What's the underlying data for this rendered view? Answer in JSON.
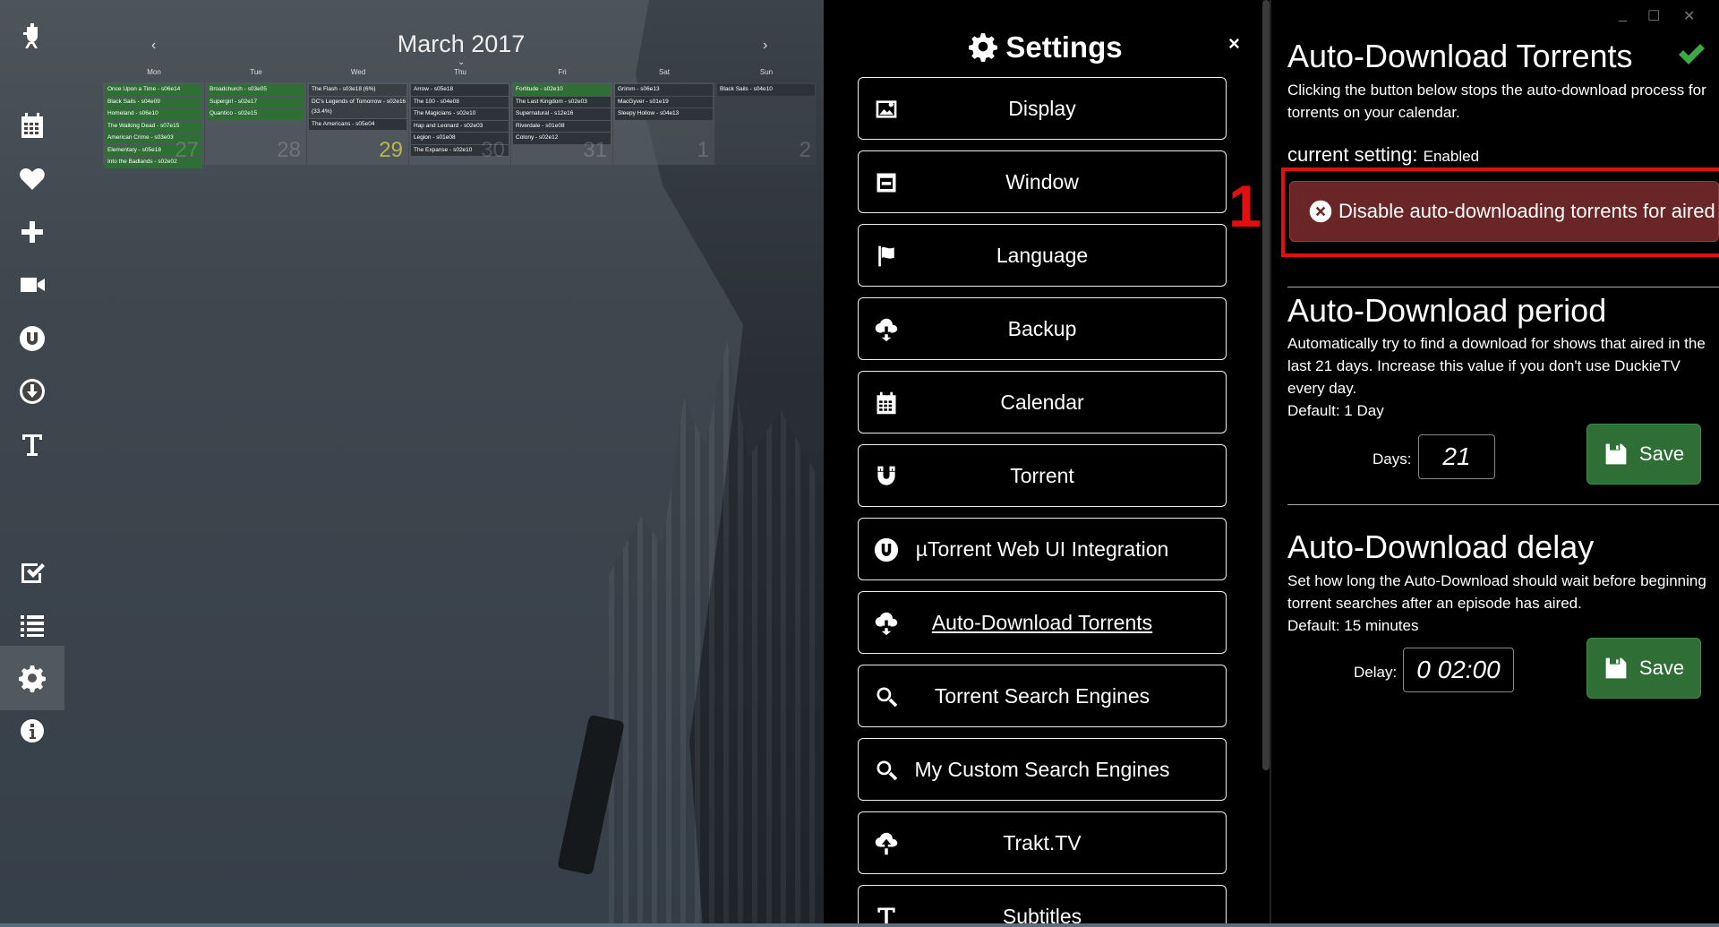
{
  "calendar": {
    "title": "March 2017",
    "prev": "‹",
    "next": "›",
    "expand": "⌄",
    "days": [
      "Mon",
      "Tue",
      "Wed",
      "Thu",
      "Fri",
      "Sat",
      "Sun"
    ],
    "cells": [
      {
        "num": "27",
        "events": [
          {
            "t": "Once Upon a Time - s06e14",
            "s": "g"
          },
          {
            "t": "Black Sails - s04e09",
            "s": "g"
          },
          {
            "t": "Homeland - s06e10",
            "s": "g"
          },
          {
            "t": "The Walking Dead - s07e15",
            "s": "g"
          },
          {
            "t": "American Crime - s03e03",
            "s": "g"
          },
          {
            "t": "Elementary - s05e18",
            "s": "g"
          },
          {
            "t": "Into the Badlands - s02e02",
            "s": "g"
          }
        ]
      },
      {
        "num": "28",
        "events": [
          {
            "t": "Broadchurch - s03e05",
            "s": "g"
          },
          {
            "t": "Supergirl - s02e17",
            "s": "g"
          },
          {
            "t": "Quantico - s02e15",
            "s": "g"
          }
        ]
      },
      {
        "num": "29",
        "today": true,
        "events": [
          {
            "t": "The Flash - s03e18 (6%)",
            "s": ""
          },
          {
            "t": "DC's Legends of Tomorrow - s02e16 (33.4%)",
            "s": ""
          },
          {
            "t": "The Americans - s05e04",
            "s": "d"
          }
        ]
      },
      {
        "num": "30",
        "events": [
          {
            "t": "Arrow - s05e18",
            "s": "d"
          },
          {
            "t": "The 100 - s04e08",
            "s": "d"
          },
          {
            "t": "The Magicians - s02e10",
            "s": "d"
          },
          {
            "t": "Hap and Leonard - s02e03",
            "s": "d"
          },
          {
            "t": "Legion - s01e08",
            "s": "d"
          },
          {
            "t": "The Expanse - s02e10",
            "s": "d"
          }
        ]
      },
      {
        "num": "31",
        "events": [
          {
            "t": "Fortitude - s02e10",
            "s": "g"
          },
          {
            "t": "The Last Kingdom - s02e03",
            "s": "d"
          },
          {
            "t": "Supernatural - s12e16",
            "s": "d"
          },
          {
            "t": "Riverdale - s01e08",
            "s": "d"
          },
          {
            "t": "Colony - s02e12",
            "s": "d"
          }
        ]
      },
      {
        "num": "1",
        "events": [
          {
            "t": "Grimm - s06e13",
            "s": "d"
          },
          {
            "t": "MacGyver - s01e19",
            "s": "d"
          },
          {
            "t": "Sleepy Hollow - s04e13",
            "s": "d"
          }
        ]
      },
      {
        "num": "2",
        "events": [
          {
            "t": "Black Sails - s04e10",
            "s": "d"
          }
        ]
      }
    ]
  },
  "rail": [
    {
      "name": "logo-icon"
    },
    {
      "name": "calendar-icon"
    },
    {
      "name": "heart-icon"
    },
    {
      "name": "plus-icon"
    },
    {
      "name": "video-camera-icon"
    },
    {
      "name": "utorrent-icon"
    },
    {
      "name": "download-icon"
    },
    {
      "name": "text-icon"
    },
    {
      "name": "checkbox-icon"
    },
    {
      "name": "list-icon"
    },
    {
      "name": "gear-icon"
    },
    {
      "name": "info-icon"
    }
  ],
  "settings": {
    "title": "Settings",
    "close": "×",
    "buttons": [
      {
        "label": "Display",
        "icon": "image-icon"
      },
      {
        "label": "Window",
        "icon": "window-icon"
      },
      {
        "label": "Language",
        "icon": "flag-icon"
      },
      {
        "label": "Backup",
        "icon": "cloud-download-icon"
      },
      {
        "label": "Calendar",
        "icon": "calendar-icon"
      },
      {
        "label": "Torrent",
        "icon": "magnet-icon"
      },
      {
        "label": "µTorrent Web UI Integration",
        "icon": "utorrent-icon"
      },
      {
        "label": "Auto-Download Torrents",
        "icon": "cloud-download-icon"
      },
      {
        "label": "Torrent Search Engines",
        "icon": "search-icon"
      },
      {
        "label": "My Custom Search Engines",
        "icon": "search-icon"
      },
      {
        "label": "Trakt.TV",
        "icon": "cloud-upload-icon"
      },
      {
        "label": "Subtitles",
        "icon": "text-icon"
      }
    ]
  },
  "detail": {
    "window_controls": [
      "_",
      "☐",
      "✕"
    ],
    "title": "Auto-Download Torrents",
    "description": "Clicking the button below stops the auto-download process for torrents on your calendar.",
    "current_label": "current setting:",
    "current_value": "Enabled",
    "disable_button": "Disable auto-downloading torrents for aired episodes",
    "annotation": "1",
    "period": {
      "title": "Auto-Download period",
      "description": "Automatically try to find a download for shows that aired in the last 21 days. Increase this value if you don't use DuckieTV every day.",
      "default": "Default: 1 Day",
      "field_label": "Days:",
      "value": "21",
      "save": "Save"
    },
    "delay": {
      "title": "Auto-Download delay",
      "description": "Set how long the Auto-Download should wait before beginning torrent searches after an episode has aired.",
      "default": "Default: 15 minutes",
      "field_label": "Delay:",
      "value": "0 02:00",
      "save": "Save"
    }
  },
  "colors": {
    "save_green": "#2f6e35",
    "disable_red": "#6a2626",
    "annotation_red": "#e01010",
    "check_green": "#3ea845"
  }
}
